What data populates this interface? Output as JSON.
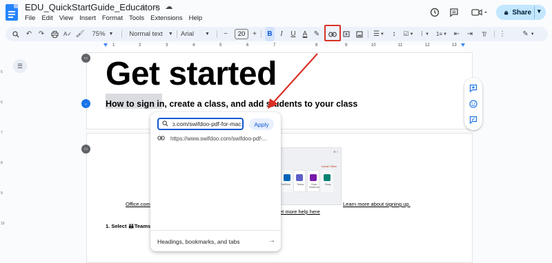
{
  "header": {
    "doc_title": "EDU_QuickStartGuide_Educators",
    "title_icons": [
      "star-icon",
      "folder-move-icon",
      "cloud-saved-icon"
    ],
    "menu": [
      "File",
      "Edit",
      "View",
      "Insert",
      "Format",
      "Tools",
      "Extensions",
      "Help"
    ],
    "right_icons": [
      "history-icon",
      "comment-icon",
      "meet-icon"
    ],
    "share_label": "Share"
  },
  "toolbar": {
    "zoom": "75%",
    "style": "Normal text",
    "font": "Arial",
    "font_size": "20",
    "bold": "B",
    "italic": "I",
    "underline": "U",
    "text_color": "A",
    "minus": "−",
    "plus": "+"
  },
  "ruler": {
    "numbers": [
      "1",
      "2",
      "3",
      "4",
      "5",
      "6",
      "7",
      "8",
      "9",
      "10",
      "11",
      "12",
      "13"
    ]
  },
  "vruler": {
    "numbers": [
      "5",
      "6",
      "7",
      "8",
      "9",
      "10"
    ]
  },
  "document": {
    "heading": "Get started",
    "subheading": "How to sign in, create a class, and add students to your class",
    "image_header": "Install Office",
    "image_tiles": [
      {
        "label": "OneDrive",
        "color": "#0364b8"
      },
      {
        "label": "Teams",
        "color": "#5b5fc7"
      },
      {
        "label": "Class Notebook",
        "color": "#7719aa"
      },
      {
        "label": "Sway",
        "color": "#008272"
      }
    ],
    "link_office": "Office.com",
    "link_learn_more": "Learn more about signing up.",
    "link_help": "et more help here",
    "step_text": "1. Select 👪Teams"
  },
  "link_popup": {
    "input_value": "https://www.swifdoo.com/swifdoo-pdf-for-mac",
    "apply_label": "Apply",
    "suggestion_text": "https://www.swifdoo.com/swifdoo-pdf-...",
    "footer_label": "Headings, bookmarks, and tabs"
  },
  "colors": {
    "accent": "#0b57d0",
    "share_bg": "#c2e7ff",
    "toolbar_bg": "#edf2fa",
    "annotation_red": "#d93025"
  }
}
